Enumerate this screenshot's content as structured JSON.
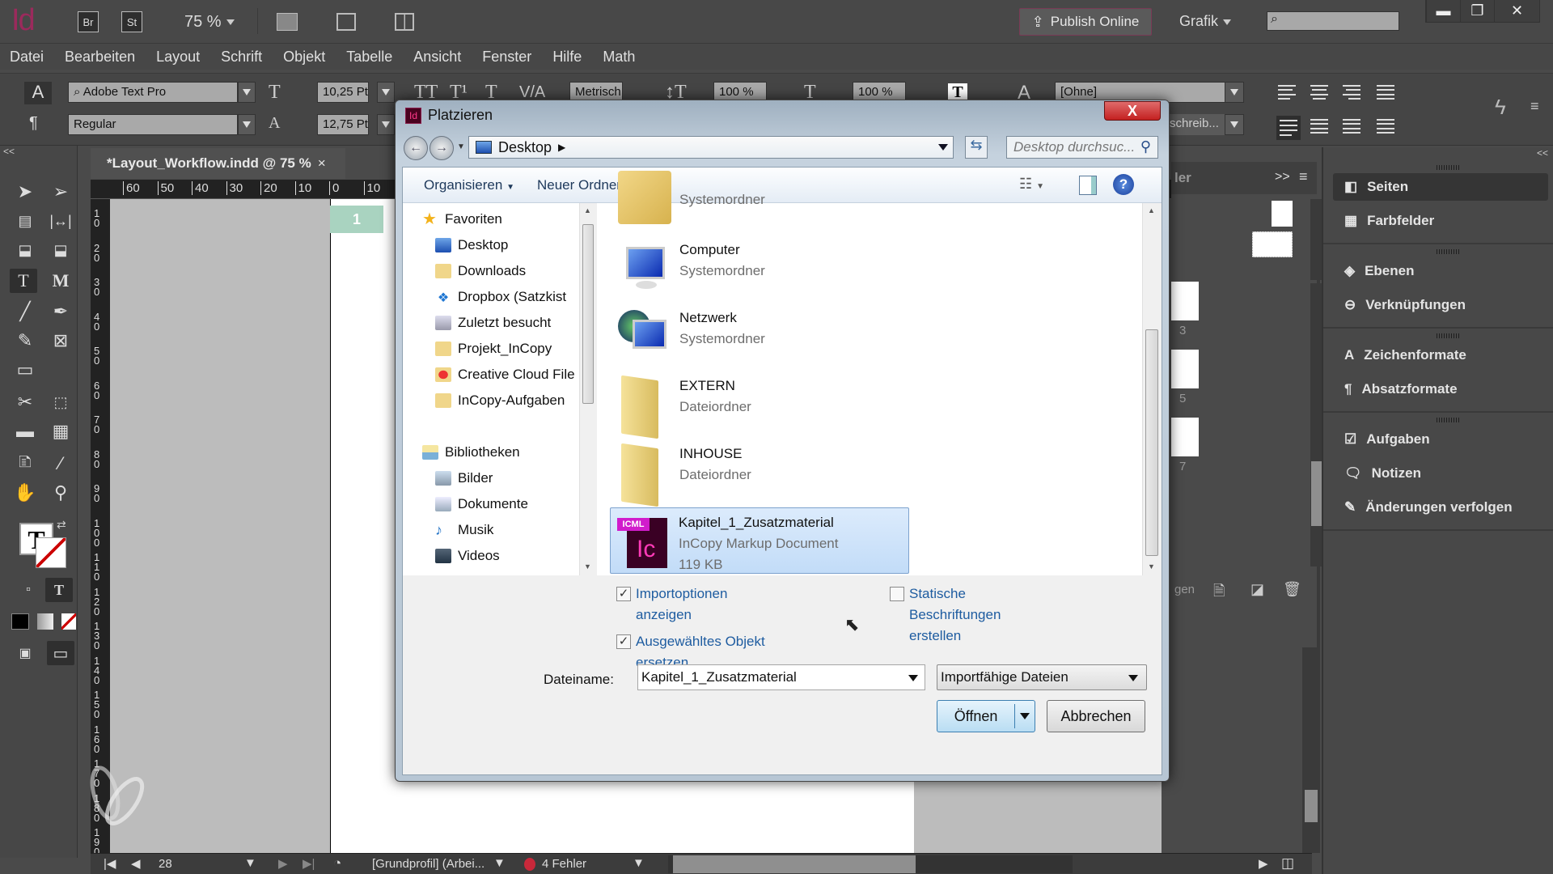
{
  "app": {
    "logo": "Id",
    "bridge_label": "Br",
    "stock_label": "St",
    "zoom": "75 %",
    "publish_label": "Publish Online",
    "workspace": "Grafik",
    "search_placeholder": "",
    "window_controls": [
      "minimize",
      "restore",
      "close"
    ]
  },
  "menu": [
    "Datei",
    "Bearbeiten",
    "Layout",
    "Schrift",
    "Objekt",
    "Tabelle",
    "Ansicht",
    "Fenster",
    "Hilfe",
    "Math"
  ],
  "control": {
    "font_family": "Adobe Text Pro",
    "font_style": "Regular",
    "font_size": "10,25 Pt",
    "leading": "12,75 Pt",
    "kerning": "Metrisch",
    "vertical_scale": "100 %",
    "horizontal_scale": "100 %",
    "char_style": "[Ohne]",
    "lang_partial": "schreib..."
  },
  "document": {
    "tab_title": "*Layout_Workflow.indd @ 75 %",
    "page_badge": "1",
    "hruler_ticks": [
      "60",
      "50",
      "40",
      "30",
      "20",
      "10",
      "0",
      "10"
    ],
    "vruler_ticks": [
      "10",
      "20",
      "30",
      "40",
      "50",
      "60",
      "70",
      "80",
      "90",
      "100",
      "110",
      "120",
      "130",
      "140",
      "150",
      "160",
      "170",
      "180",
      "190"
    ]
  },
  "status": {
    "page_number": "28",
    "profile": "[Grundprofil] (Arbei...",
    "errors": "4 Fehler",
    "error_color": "#c8283a"
  },
  "pages_panel": {
    "tab_partial": "ler",
    "page_labels": [
      "3",
      "5",
      "7"
    ],
    "footer_partial": "gen"
  },
  "right_panel": {
    "groups": [
      [
        {
          "label": "Seiten",
          "icon": "pages-icon",
          "active": true
        },
        {
          "label": "Farbfelder",
          "icon": "swatches-icon"
        }
      ],
      [
        {
          "label": "Ebenen",
          "icon": "layers-icon"
        },
        {
          "label": "Verknüpfungen",
          "icon": "links-icon"
        }
      ],
      [
        {
          "label": "Zeichenformate",
          "icon": "character-styles-icon"
        },
        {
          "label": "Absatzformate",
          "icon": "paragraph-styles-icon"
        }
      ],
      [
        {
          "label": "Aufgaben",
          "icon": "assignments-icon"
        },
        {
          "label": "Notizen",
          "icon": "notes-icon"
        },
        {
          "label": "Änderungen verfolgen",
          "icon": "track-changes-icon"
        }
      ]
    ]
  },
  "dialog": {
    "title": "Platzieren",
    "close_label": "X",
    "address": "Desktop",
    "search_placeholder": "Desktop durchsuc...",
    "organize_label": "Organisieren",
    "new_folder_label": "Neuer Ordner",
    "nav": {
      "favorites_header": "Favoriten",
      "favorites": [
        "Desktop",
        "Downloads",
        "Dropbox (Satzkist",
        "Zuletzt besucht",
        "Projekt_InCopy",
        "Creative Cloud File",
        "InCopy-Aufgaben"
      ],
      "libraries_header": "Bibliotheken",
      "libraries": [
        "Bilder",
        "Dokumente",
        "Musik",
        "Videos"
      ]
    },
    "files": [
      {
        "name": "",
        "type": "Systemordner",
        "icon": "user-folder-icon"
      },
      {
        "name": "Computer",
        "type": "Systemordner",
        "icon": "computer-icon"
      },
      {
        "name": "Netzwerk",
        "type": "Systemordner",
        "icon": "network-icon"
      },
      {
        "name": "EXTERN",
        "type": "Dateiordner",
        "icon": "folder-icon"
      },
      {
        "name": "INHOUSE",
        "type": "Dateiordner",
        "icon": "folder-icon"
      },
      {
        "name": "Kapitel_1_Zusatzmaterial",
        "type": "InCopy Markup Document",
        "size": "119 KB",
        "icon": "icml-file-icon",
        "selected": true
      }
    ],
    "options": {
      "import_options": {
        "label1": "Importoptionen",
        "label2": "anzeigen",
        "checked": true
      },
      "replace_selected": {
        "label1": "Ausgewähltes Objekt",
        "label2": "ersetzen",
        "checked": true
      },
      "static_captions": {
        "label1": "Statische",
        "label2": "Beschriftungen",
        "label3": "erstellen",
        "checked": false
      }
    },
    "filename_label": "Dateiname:",
    "filename_value": "Kapitel_1_Zusatzmaterial",
    "filetype_value": "Importfähige Dateien",
    "open_label": "Öffnen",
    "cancel_label": "Abbrechen"
  }
}
